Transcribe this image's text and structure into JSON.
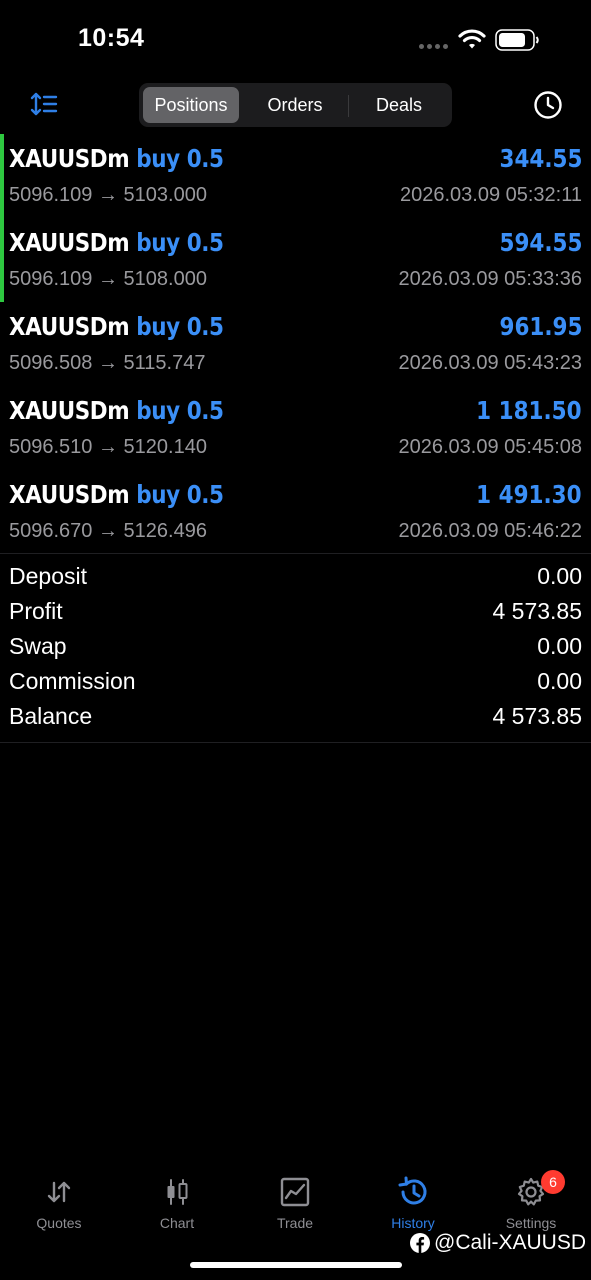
{
  "status_bar": {
    "time": "10:54"
  },
  "toolbar": {
    "tabs": [
      {
        "label": "Positions"
      },
      {
        "label": "Orders"
      },
      {
        "label": "Deals"
      }
    ]
  },
  "positions": [
    {
      "symbol": "XAUUSDm",
      "type": "buy 0.5",
      "profit": "344.55",
      "open_price": "5096.109",
      "arrow": "→",
      "close_price": "5103.000",
      "time": "2026.03.09 05:32:11"
    },
    {
      "symbol": "XAUUSDm",
      "type": "buy 0.5",
      "profit": "594.55",
      "open_price": "5096.109",
      "arrow": "→",
      "close_price": "5108.000",
      "time": "2026.03.09 05:33:36"
    },
    {
      "symbol": "XAUUSDm",
      "type": "buy 0.5",
      "profit": "961.95",
      "open_price": "5096.508",
      "arrow": "→",
      "close_price": "5115.747",
      "time": "2026.03.09 05:43:23"
    },
    {
      "symbol": "XAUUSDm",
      "type": "buy 0.5",
      "profit": "1 181.50",
      "open_price": "5096.510",
      "arrow": "→",
      "close_price": "5120.140",
      "time": "2026.03.09 05:45:08"
    },
    {
      "symbol": "XAUUSDm",
      "type": "buy 0.5",
      "profit": "1 491.30",
      "open_price": "5096.670",
      "arrow": "→",
      "close_price": "5126.496",
      "time": "2026.03.09 05:46:22"
    }
  ],
  "summary": [
    {
      "label": "Deposit",
      "value": "0.00"
    },
    {
      "label": "Profit",
      "value": "4 573.85"
    },
    {
      "label": "Swap",
      "value": "0.00"
    },
    {
      "label": "Commission",
      "value": "0.00"
    },
    {
      "label": "Balance",
      "value": "4 573.85"
    }
  ],
  "bottom_nav": {
    "items": [
      {
        "label": "Quotes",
        "icon": "quotes-icon"
      },
      {
        "label": "Chart",
        "icon": "candlestick-icon"
      },
      {
        "label": "Trade",
        "icon": "trade-icon"
      },
      {
        "label": "History",
        "icon": "history-icon"
      },
      {
        "label": "Settings",
        "icon": "gear-icon"
      }
    ],
    "settings_badge": "6"
  },
  "watermark": {
    "text": "@Cali-XAUUSD"
  },
  "colors": {
    "accent": "#3b8ff7",
    "active_indicator": "#2ec840",
    "badge": "#ff3b30"
  }
}
